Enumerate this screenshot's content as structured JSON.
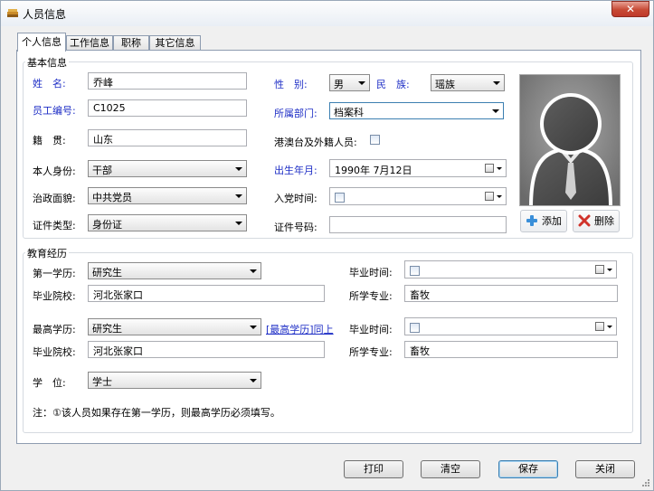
{
  "window": {
    "title": "人员信息",
    "close_label": "✕"
  },
  "tabs": [
    {
      "label": "个人信息",
      "active": true
    },
    {
      "label": "工作信息",
      "active": false
    },
    {
      "label": "职称",
      "active": false
    },
    {
      "label": "其它信息",
      "active": false
    }
  ],
  "basic": {
    "group_title": "基本信息",
    "name": {
      "label": "姓　名:",
      "value": "乔峰"
    },
    "gender": {
      "label": "性　别:",
      "value": "男"
    },
    "ethnicity": {
      "label": "民　族:",
      "value": "瑶族"
    },
    "employee_no": {
      "label": "员工编号:",
      "value": "C1025"
    },
    "department": {
      "label": "所属部门:",
      "value": "档案科"
    },
    "native_place": {
      "label": "籍　贯:",
      "value": "山东"
    },
    "hk_macau_tw": {
      "label": "港澳台及外籍人员:",
      "checked": false
    },
    "identity": {
      "label": "本人身份:",
      "value": "干部"
    },
    "birth_date": {
      "label": "出生年月:",
      "value": "1990年 7月12日"
    },
    "political": {
      "label": "治政面貌:",
      "value": "中共党员"
    },
    "party_date": {
      "label": "入党时间:",
      "value": ""
    },
    "id_type": {
      "label": "证件类型:",
      "value": "身份证"
    },
    "id_number": {
      "label": "证件号码:",
      "value": ""
    },
    "add_photo_label": "添加",
    "delete_photo_label": "删除"
  },
  "education": {
    "group_title": "教育经历",
    "first_degree": {
      "label": "第一学历:",
      "value": "研究生"
    },
    "first_grad_time": {
      "label": "毕业时间:",
      "value": ""
    },
    "first_school": {
      "label": "毕业院校:",
      "value": "河北张家口"
    },
    "first_major": {
      "label": "所学专业:",
      "value": "畜牧"
    },
    "highest_degree": {
      "label": "最高学历:",
      "value": "研究生"
    },
    "same_link": "[最高学历]同上",
    "highest_grad_time": {
      "label": "毕业时间:",
      "value": ""
    },
    "highest_school": {
      "label": "毕业院校:",
      "value": "河北张家口"
    },
    "highest_major": {
      "label": "所学专业:",
      "value": "畜牧"
    },
    "academic_degree": {
      "label": "学　位:",
      "value": "学士"
    },
    "note": "注：①该人员如果存在第一学历，则最高学历必须填写。"
  },
  "buttons": {
    "print": "打印",
    "clear": "清空",
    "save": "保存",
    "close": "关闭"
  },
  "colors": {
    "required_label": "#1f2fc6",
    "link": "#1f2fc6",
    "close_button": "#c74a35",
    "delete_icon": "#d0322a",
    "add_icon": "#3a8fd9"
  }
}
